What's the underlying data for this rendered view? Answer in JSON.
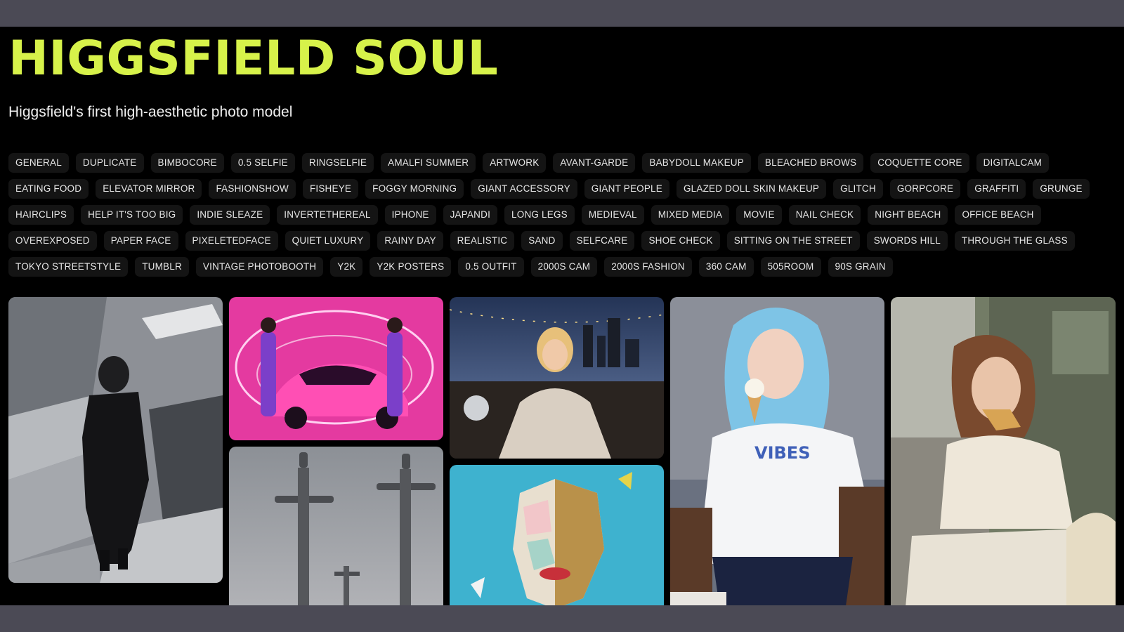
{
  "header": {
    "title": "HIGGSFIELD SOUL",
    "subtitle": "Higgsfield's first high-aesthetic photo model",
    "accent_color": "#d7f24a"
  },
  "tags": [
    "GENERAL",
    "DUPLICATE",
    "BIMBOCORE",
    "0.5 SELFIE",
    "RINGSELFIE",
    "AMALFI SUMMER",
    "ARTWORK",
    "AVANT-GARDE",
    "BABYDOLL MAKEUP",
    "BLEACHED BROWS",
    "COQUETTE CORE",
    "DIGITALCAM",
    "EATING FOOD",
    "ELEVATOR MIRROR",
    "FASHIONSHOW",
    "FISHEYE",
    "FOGGY MORNING",
    "GIANT ACCESSORY",
    "GIANT PEOPLE",
    "GLAZED DOLL SKIN MAKEUP",
    "GLITCH",
    "GORPCORE",
    "GRAFFITI",
    "GRUNGE",
    "HAIRCLIPS",
    "HELP IT'S TOO BIG",
    "INDIE SLEAZE",
    "INVERTETHEREAL",
    "IPHONE",
    "JAPANDI",
    "LONG LEGS",
    "MEDIEVAL",
    "MIXED MEDIA",
    "MOVIE",
    "NAIL CHECK",
    "NIGHT BEACH",
    "OFFICE BEACH",
    "OVEREXPOSED",
    "PAPER FACE",
    "PIXELETEDFACE",
    "QUIET LUXURY",
    "RAINY DAY",
    "REALISTIC",
    "SAND",
    "SELFCARE",
    "SHOE CHECK",
    "SITTING ON THE STREET",
    "SWORDS HILL",
    "THROUGH THE GLASS",
    "TOKYO STREETSTYLE",
    "TUMBLR",
    "VINTAGE PHOTOBOOTH",
    "Y2K",
    "Y2K POSTERS",
    "0.5 OUTFIT",
    "2000S CAM",
    "2000S FASHION",
    "360 CAM",
    "505ROOM",
    "90S GRAIN"
  ],
  "gallery": [
    {
      "id": "concrete-portrait",
      "bg": "#8d9096"
    },
    {
      "id": "pink-car",
      "bg": "#e43aa0"
    },
    {
      "id": "swords",
      "bg": "#9a9da3"
    },
    {
      "id": "night-spaghetti",
      "bg": "#2c3c5c"
    },
    {
      "id": "paper-face",
      "bg": "#3eb2cf"
    },
    {
      "id": "blue-hair-icecream",
      "bg": "#6a7180",
      "shirt_text": "VIBES"
    },
    {
      "id": "croissant-street",
      "bg": "#737c66"
    }
  ]
}
